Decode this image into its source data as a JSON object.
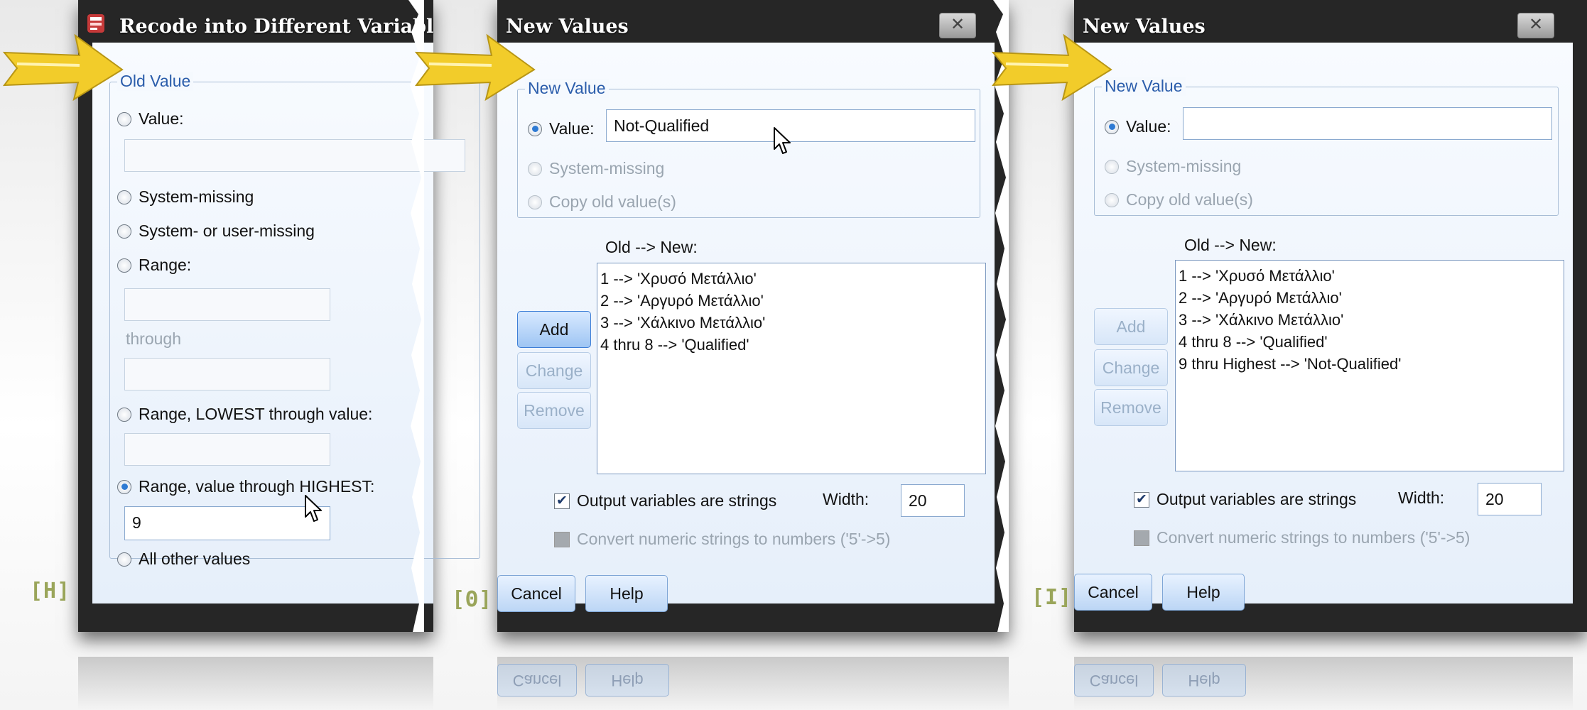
{
  "panel_h": {
    "title": "Recode into Different Variabl",
    "step_label": "[H]",
    "group_legend": "Old Value",
    "options": {
      "value": "Value:",
      "system_missing": "System-missing",
      "system_or_user_missing": "System- or user-missing",
      "range": "Range:",
      "through": "through",
      "range_lowest": "Range, LOWEST through value:",
      "range_highest": "Range, value through HIGHEST:",
      "all_other": "All other values"
    },
    "selected_option": "range_highest",
    "highest_value": "9"
  },
  "panel_theta": {
    "title": "New Values",
    "step_label": "[Θ]",
    "group_legend": "New Value",
    "value_label": "Value:",
    "value_input": "Not-Qualified",
    "system_missing": "System-missing",
    "copy_old": "Copy old value(s)",
    "list_header": "Old --> New:",
    "list_items": [
      "1 --> 'Χρυσό Μετάλλιο'",
      "2 --> 'Αργυρό Μετάλλιο'",
      "3 --> 'Χάλκινο Μετάλλιο'",
      "4 thru 8 --> 'Qualified'"
    ],
    "add": "Add",
    "change": "Change",
    "remove": "Remove",
    "output_strings": "Output variables are strings",
    "width_label": "Width:",
    "width_value": "20",
    "convert_numeric": "Convert numeric strings to numbers ('5'->5)",
    "cancel": "Cancel",
    "help": "Help"
  },
  "panel_i": {
    "title": "New Values",
    "step_label": "[I]",
    "group_legend": "New Value",
    "value_label": "Value:",
    "value_input": "",
    "system_missing": "System-missing",
    "copy_old": "Copy old value(s)",
    "list_header": "Old --> New:",
    "list_items": [
      "1 --> 'Χρυσό Μετάλλιο'",
      "2 --> 'Αργυρό Μετάλλιο'",
      "3 --> 'Χάλκινο Μετάλλιο'",
      "4 thru 8 --> 'Qualified'",
      "9 thru Highest --> 'Not-Qualified'"
    ],
    "add": "Add",
    "change": "Change",
    "remove": "Remove",
    "output_strings": "Output variables are strings",
    "width_label": "Width:",
    "width_value": "20",
    "convert_numeric": "Convert numeric strings to numbers ('5'->5)",
    "cancel": "Cancel",
    "help": "Help"
  },
  "colors": {
    "arrow": "#f2cc2a",
    "step_label": "#9aa55a",
    "legend_text": "#2b5dab"
  },
  "icons": [
    "pointer-arrow-icon",
    "mouse-cursor-icon",
    "spss-app-icon",
    "close-icon",
    "checkmark-icon"
  ]
}
